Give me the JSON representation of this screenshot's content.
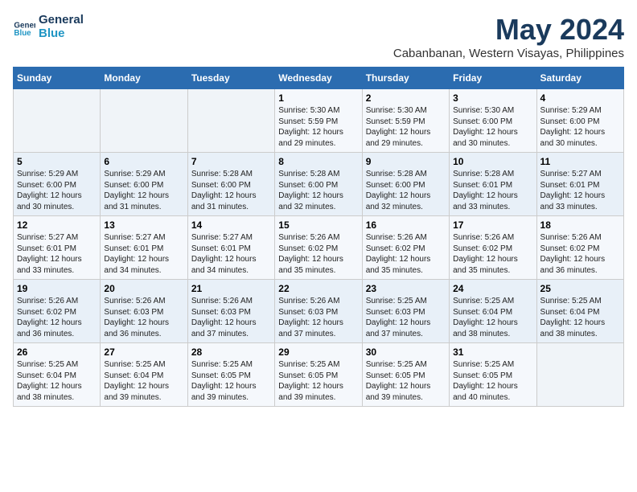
{
  "logo": {
    "line1": "General",
    "line2": "Blue"
  },
  "title": "May 2024",
  "subtitle": "Cabanbanan, Western Visayas, Philippines",
  "header": {
    "days": [
      "Sunday",
      "Monday",
      "Tuesday",
      "Wednesday",
      "Thursday",
      "Friday",
      "Saturday"
    ]
  },
  "weeks": [
    [
      {
        "day": "",
        "info": ""
      },
      {
        "day": "",
        "info": ""
      },
      {
        "day": "",
        "info": ""
      },
      {
        "day": "1",
        "info": "Sunrise: 5:30 AM\nSunset: 5:59 PM\nDaylight: 12 hours\nand 29 minutes."
      },
      {
        "day": "2",
        "info": "Sunrise: 5:30 AM\nSunset: 5:59 PM\nDaylight: 12 hours\nand 29 minutes."
      },
      {
        "day": "3",
        "info": "Sunrise: 5:30 AM\nSunset: 6:00 PM\nDaylight: 12 hours\nand 30 minutes."
      },
      {
        "day": "4",
        "info": "Sunrise: 5:29 AM\nSunset: 6:00 PM\nDaylight: 12 hours\nand 30 minutes."
      }
    ],
    [
      {
        "day": "5",
        "info": "Sunrise: 5:29 AM\nSunset: 6:00 PM\nDaylight: 12 hours\nand 30 minutes."
      },
      {
        "day": "6",
        "info": "Sunrise: 5:29 AM\nSunset: 6:00 PM\nDaylight: 12 hours\nand 31 minutes."
      },
      {
        "day": "7",
        "info": "Sunrise: 5:28 AM\nSunset: 6:00 PM\nDaylight: 12 hours\nand 31 minutes."
      },
      {
        "day": "8",
        "info": "Sunrise: 5:28 AM\nSunset: 6:00 PM\nDaylight: 12 hours\nand 32 minutes."
      },
      {
        "day": "9",
        "info": "Sunrise: 5:28 AM\nSunset: 6:00 PM\nDaylight: 12 hours\nand 32 minutes."
      },
      {
        "day": "10",
        "info": "Sunrise: 5:28 AM\nSunset: 6:01 PM\nDaylight: 12 hours\nand 33 minutes."
      },
      {
        "day": "11",
        "info": "Sunrise: 5:27 AM\nSunset: 6:01 PM\nDaylight: 12 hours\nand 33 minutes."
      }
    ],
    [
      {
        "day": "12",
        "info": "Sunrise: 5:27 AM\nSunset: 6:01 PM\nDaylight: 12 hours\nand 33 minutes."
      },
      {
        "day": "13",
        "info": "Sunrise: 5:27 AM\nSunset: 6:01 PM\nDaylight: 12 hours\nand 34 minutes."
      },
      {
        "day": "14",
        "info": "Sunrise: 5:27 AM\nSunset: 6:01 PM\nDaylight: 12 hours\nand 34 minutes."
      },
      {
        "day": "15",
        "info": "Sunrise: 5:26 AM\nSunset: 6:02 PM\nDaylight: 12 hours\nand 35 minutes."
      },
      {
        "day": "16",
        "info": "Sunrise: 5:26 AM\nSunset: 6:02 PM\nDaylight: 12 hours\nand 35 minutes."
      },
      {
        "day": "17",
        "info": "Sunrise: 5:26 AM\nSunset: 6:02 PM\nDaylight: 12 hours\nand 35 minutes."
      },
      {
        "day": "18",
        "info": "Sunrise: 5:26 AM\nSunset: 6:02 PM\nDaylight: 12 hours\nand 36 minutes."
      }
    ],
    [
      {
        "day": "19",
        "info": "Sunrise: 5:26 AM\nSunset: 6:02 PM\nDaylight: 12 hours\nand 36 minutes."
      },
      {
        "day": "20",
        "info": "Sunrise: 5:26 AM\nSunset: 6:03 PM\nDaylight: 12 hours\nand 36 minutes."
      },
      {
        "day": "21",
        "info": "Sunrise: 5:26 AM\nSunset: 6:03 PM\nDaylight: 12 hours\nand 37 minutes."
      },
      {
        "day": "22",
        "info": "Sunrise: 5:26 AM\nSunset: 6:03 PM\nDaylight: 12 hours\nand 37 minutes."
      },
      {
        "day": "23",
        "info": "Sunrise: 5:25 AM\nSunset: 6:03 PM\nDaylight: 12 hours\nand 37 minutes."
      },
      {
        "day": "24",
        "info": "Sunrise: 5:25 AM\nSunset: 6:04 PM\nDaylight: 12 hours\nand 38 minutes."
      },
      {
        "day": "25",
        "info": "Sunrise: 5:25 AM\nSunset: 6:04 PM\nDaylight: 12 hours\nand 38 minutes."
      }
    ],
    [
      {
        "day": "26",
        "info": "Sunrise: 5:25 AM\nSunset: 6:04 PM\nDaylight: 12 hours\nand 38 minutes."
      },
      {
        "day": "27",
        "info": "Sunrise: 5:25 AM\nSunset: 6:04 PM\nDaylight: 12 hours\nand 39 minutes."
      },
      {
        "day": "28",
        "info": "Sunrise: 5:25 AM\nSunset: 6:05 PM\nDaylight: 12 hours\nand 39 minutes."
      },
      {
        "day": "29",
        "info": "Sunrise: 5:25 AM\nSunset: 6:05 PM\nDaylight: 12 hours\nand 39 minutes."
      },
      {
        "day": "30",
        "info": "Sunrise: 5:25 AM\nSunset: 6:05 PM\nDaylight: 12 hours\nand 39 minutes."
      },
      {
        "day": "31",
        "info": "Sunrise: 5:25 AM\nSunset: 6:05 PM\nDaylight: 12 hours\nand 40 minutes."
      },
      {
        "day": "",
        "info": ""
      }
    ]
  ]
}
